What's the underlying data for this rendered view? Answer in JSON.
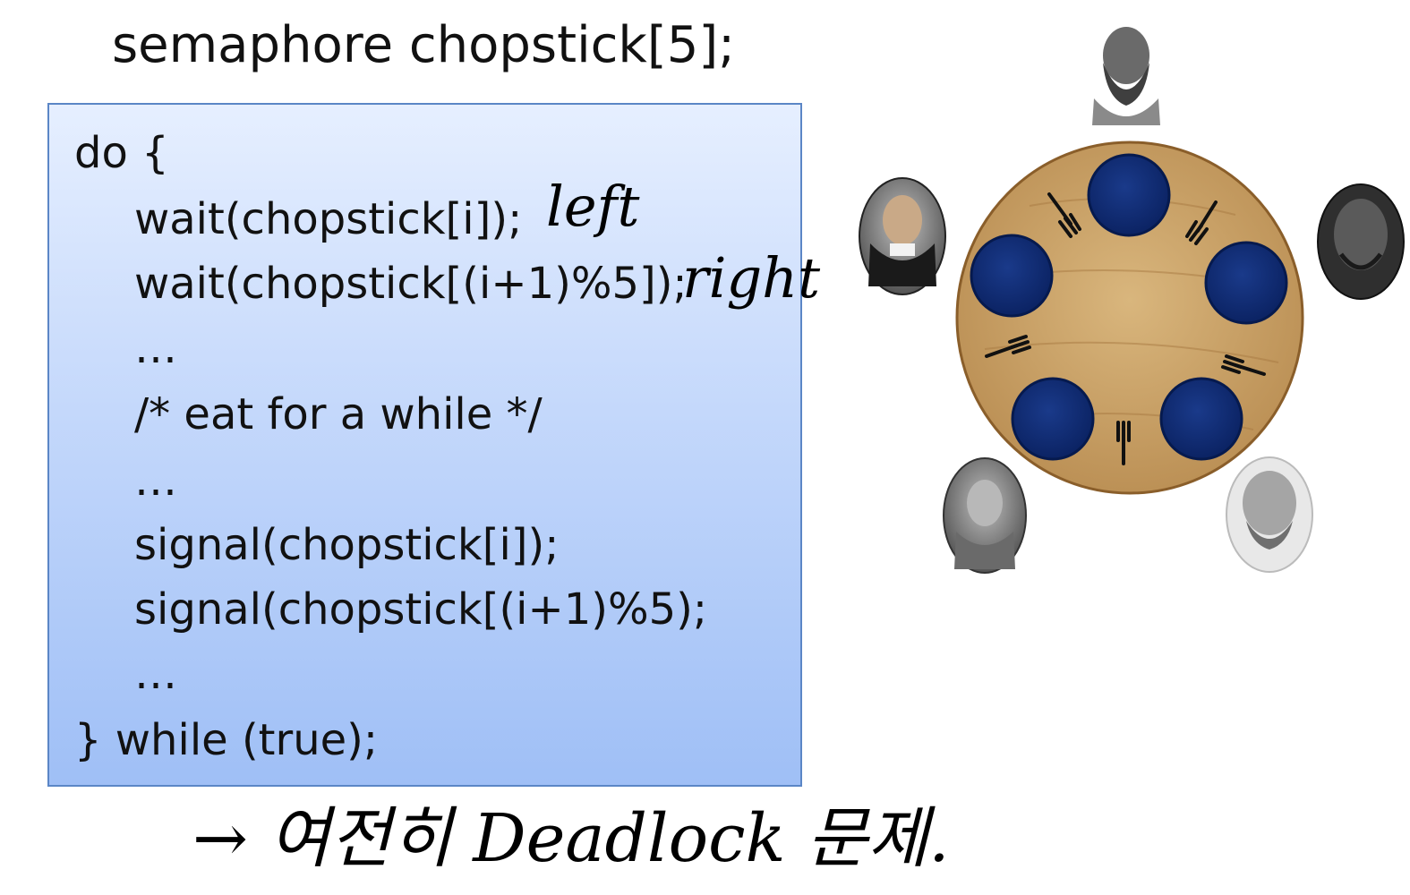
{
  "title": "semaphore chopstick[5];",
  "code": [
    "do {",
    "wait(chopstick[i]);",
    "wait(chopstick[(i+1)%5]);",
    "…",
    "/* eat for a while */",
    "…",
    "signal(chopstick[i]);",
    "signal(chopstick[(i+1)%5);",
    "…",
    "} while (true);"
  ],
  "handwriting": {
    "left": "left",
    "right": "right",
    "note": "→ 여전히 Deadlock 문제."
  },
  "icons": [
    "philosopher-portrait",
    "plate",
    "fork",
    "round-table"
  ],
  "colors": {
    "code_box_top": "#e6efff",
    "code_box_bottom": "#9fbff6",
    "code_box_border": "#5b86c6",
    "table": "#c8a26a",
    "plate": "#0c2a6e"
  }
}
